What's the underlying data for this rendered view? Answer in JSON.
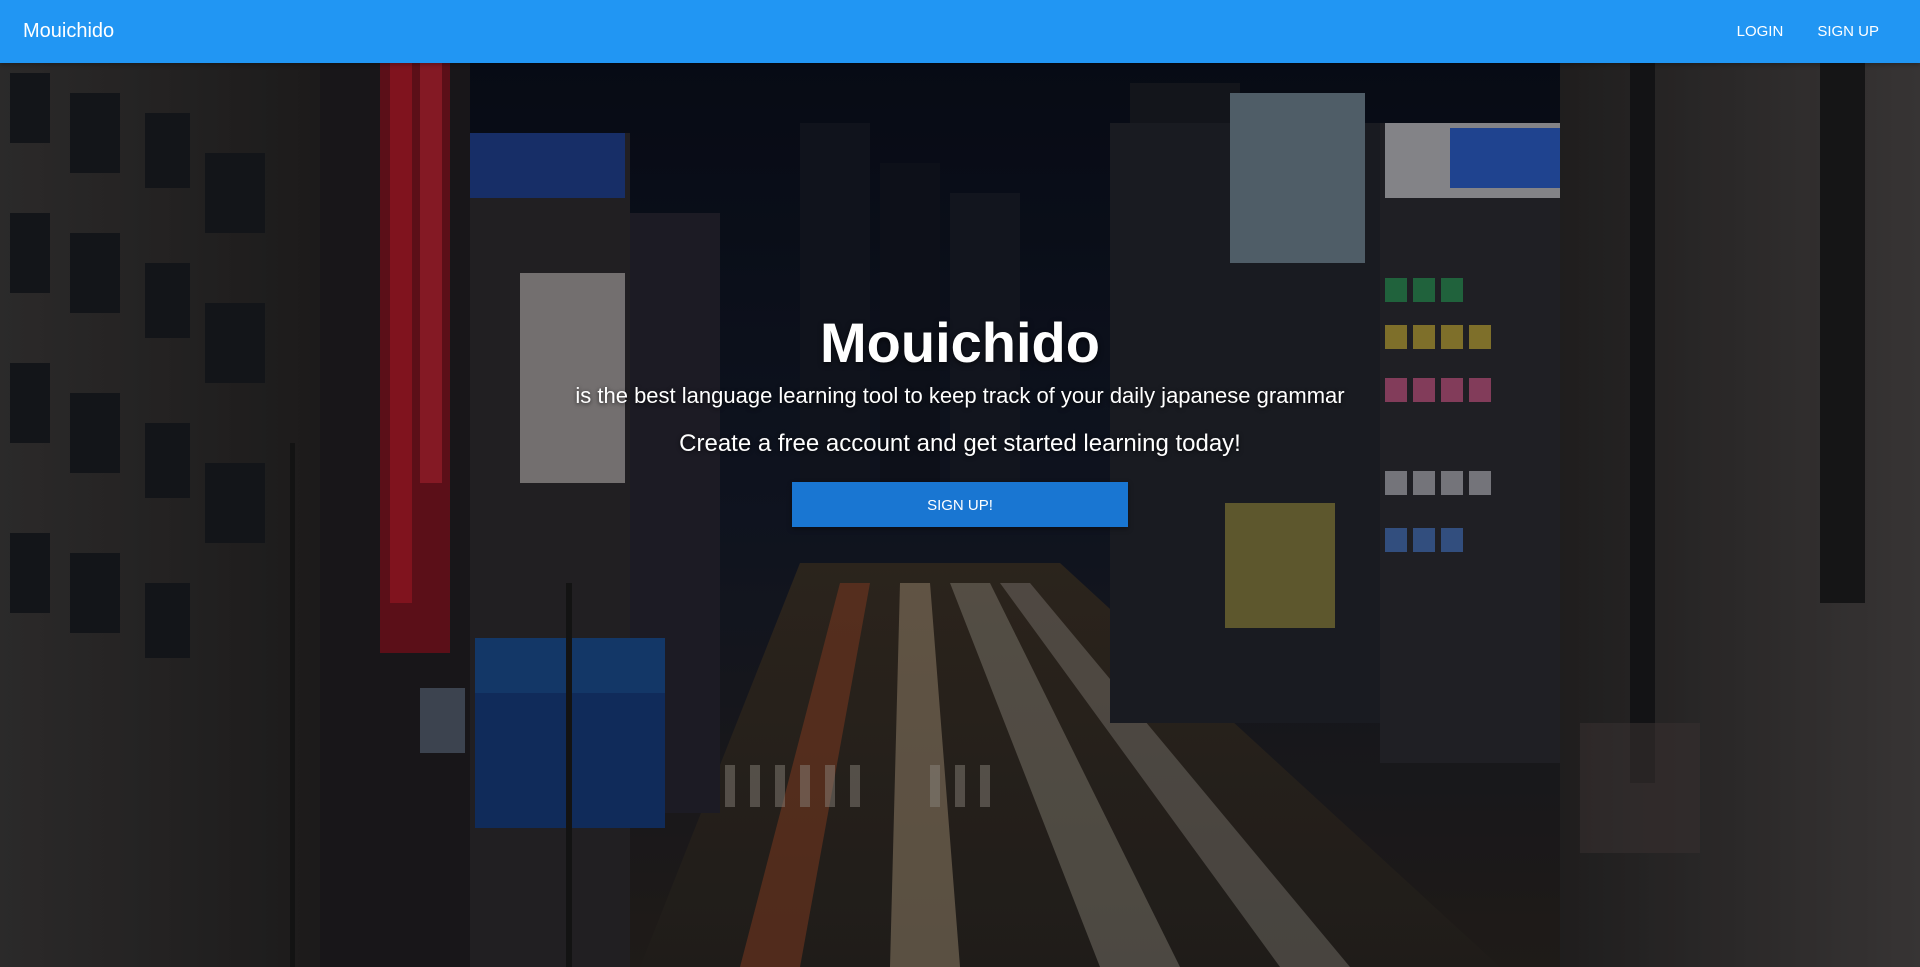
{
  "navbar": {
    "brand": "Mouichido",
    "links": [
      {
        "label": "LOGIN"
      },
      {
        "label": "SIGN UP"
      }
    ],
    "color": "#2196f3"
  },
  "hero": {
    "title": "Mouichido",
    "subtitle": "is the best language learning tool to keep track of your daily japanese grammar",
    "cta_text": "Create a free account and get started learning today!",
    "button_label": "SIGN UP!",
    "button_color": "#1976d2"
  }
}
